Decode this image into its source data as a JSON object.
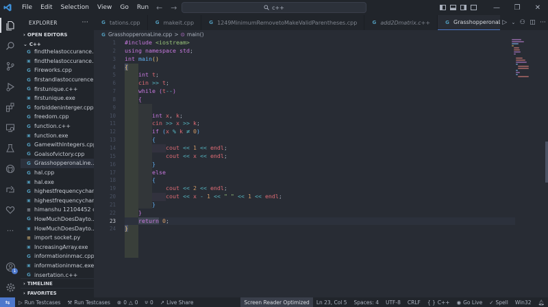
{
  "menu": [
    "File",
    "Edit",
    "Selection",
    "View",
    "Go",
    "Run"
  ],
  "search": {
    "text": "c++"
  },
  "explorer": {
    "title": "EXPLORER",
    "open_editors": "OPEN EDITORS",
    "folder": "C++"
  },
  "files": [
    {
      "name": "findthelastoccurance...",
      "kind": "cpp"
    },
    {
      "name": "findthelastoccurance...",
      "kind": "exe"
    },
    {
      "name": "Fireworks.cpp",
      "kind": "cpp"
    },
    {
      "name": "firstandlastoccurence...",
      "kind": "cpp"
    },
    {
      "name": "firstunique.c++",
      "kind": "cpp"
    },
    {
      "name": "firstunique.exe",
      "kind": "exe"
    },
    {
      "name": "forbiddeninterger.cpp",
      "kind": "cpp"
    },
    {
      "name": "freedom.cpp",
      "kind": "cpp"
    },
    {
      "name": "function.c++",
      "kind": "cpp"
    },
    {
      "name": "function.exe",
      "kind": "exe"
    },
    {
      "name": "GamewithIntegers.cpp",
      "kind": "cpp"
    },
    {
      "name": "Goalsofvictory.cpp",
      "kind": "cpp"
    },
    {
      "name": "GrasshopperonaLine....",
      "kind": "cpp",
      "active": true
    },
    {
      "name": "hal.cpp",
      "kind": "cpp"
    },
    {
      "name": "hal.exe",
      "kind": "exe"
    },
    {
      "name": "highestfrequencychar...",
      "kind": "cpp"
    },
    {
      "name": "highestfrequencychar...",
      "kind": "exe"
    },
    {
      "name": "himanshu 12104452 c...",
      "kind": "txt"
    },
    {
      "name": "HowMuchDoesDayto...",
      "kind": "cpp"
    },
    {
      "name": "HowMuchDoesDayto...",
      "kind": "exe"
    },
    {
      "name": "import socket.py",
      "kind": "py"
    },
    {
      "name": "IncreasingArray.exe",
      "kind": "exe"
    },
    {
      "name": "informationinmac.cpp",
      "kind": "cpp"
    },
    {
      "name": "informationinmac.exe",
      "kind": "exe"
    },
    {
      "name": "insertation.c++",
      "kind": "cpp"
    }
  ],
  "sidebar_bottom": {
    "timeline": "TIMELINE",
    "favorites": "FAVORITES"
  },
  "tabs": [
    {
      "label": "tations.cpp",
      "italic": false
    },
    {
      "label": "makeit.cpp",
      "italic": false
    },
    {
      "label": "1249MinimumRemovetoMakeValidParentheses.cpp",
      "italic": false
    },
    {
      "label": "add2Dmatrix.c++",
      "italic": true
    },
    {
      "label": "GrasshopperonaLine.cpp",
      "italic": false,
      "active": true
    }
  ],
  "breadcrumb": {
    "file": "GrasshopperonaLine.cpp",
    "sep": ">",
    "symbol": "main()"
  },
  "current_line": 23,
  "status": {
    "run1": "Run Testcases",
    "run2": "Run Testcases",
    "errors": "0",
    "warnings": "0",
    "ports": "0",
    "live_share": "Live Share",
    "screen_reader": "Screen Reader Optimized",
    "position": "Ln 23, Col 5",
    "spaces": "Spaces: 4",
    "encoding": "UTF-8",
    "eol": "CRLF",
    "language": "C++",
    "go_live": "Go Live",
    "spell": "Spell",
    "platform": "Win32"
  },
  "colors": {
    "accent": "#4d78cc",
    "keyword": "#c678dd",
    "function": "#61afef",
    "string": "#98c379",
    "number": "#d19a66",
    "variable": "#e06c75"
  }
}
